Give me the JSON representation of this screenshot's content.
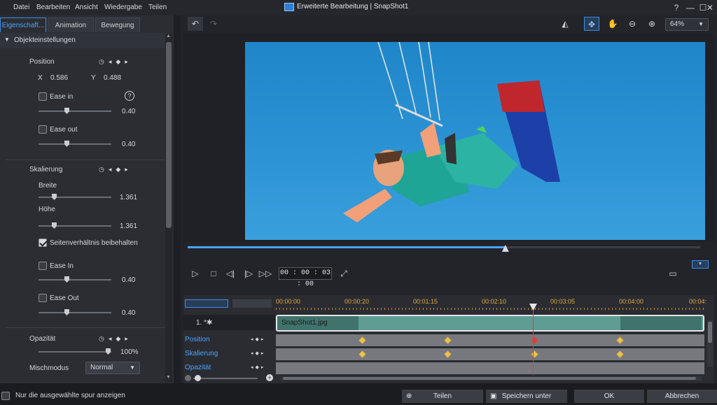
{
  "menu": [
    "Datei",
    "Bearbeiten",
    "Ansicht",
    "Wiedergabe",
    "Teilen"
  ],
  "window": {
    "title": "Erweiterte Bearbeitung  |  SnapShot1",
    "help": "?",
    "minimize": "—",
    "maximize": "☐",
    "close": "✕"
  },
  "tabs": [
    "Eigenschaft...",
    "Animation",
    "Bewegung"
  ],
  "section": {
    "title": "Objekteinstellungen"
  },
  "position": {
    "label": "Position",
    "x_label": "X",
    "x_value": "0.586",
    "y_label": "Y",
    "y_value": "0.488",
    "ease_in": {
      "label": "Ease in",
      "value": "0.40",
      "help": "?"
    },
    "ease_out": {
      "label": "Ease out",
      "value": "0.40"
    }
  },
  "scaling": {
    "label": "Skalierung",
    "width": {
      "label": "Breite",
      "value": "1.361"
    },
    "height": {
      "label": "Höhe",
      "value": "1.361"
    },
    "keep_aspect": {
      "label": "Seitenverhältnis beibehalten",
      "checked": true
    },
    "ease_in": {
      "label": "Ease In",
      "value": "0.40"
    },
    "ease_out": {
      "label": "Ease Out",
      "value": "0.40"
    }
  },
  "opacity": {
    "label": "Opazität",
    "value": "100%",
    "level": 1.0
  },
  "blend": {
    "label": "Mischmodus",
    "value": "Normal"
  },
  "toolbar": {
    "zoom": "64%"
  },
  "transport": {
    "timecode": "00 : 00 : 03 : 00",
    "progress": 0.62
  },
  "timeline": {
    "timecodes": [
      "00:00:00",
      "00:00:20",
      "00:01:15",
      "00:02:10",
      "00:03:05",
      "00:04:00",
      "00:04:"
    ],
    "track_number": "1. *✱",
    "clip_name": "SnapShot1.jpg",
    "tracks": [
      "Position",
      "Skalierung",
      "Opazität"
    ]
  },
  "bottom": {
    "only_selected": "Nur die ausgewählte spur anzeigen",
    "share": "Teilen",
    "save_as": "Speichern unter",
    "ok": "OK",
    "cancel": "Abbrechen"
  },
  "colors": {
    "accent": "#3a8ee6",
    "keyframe": "#f0c040",
    "keyframe_active": "#e0403a",
    "timecode": "#e0a93a"
  }
}
